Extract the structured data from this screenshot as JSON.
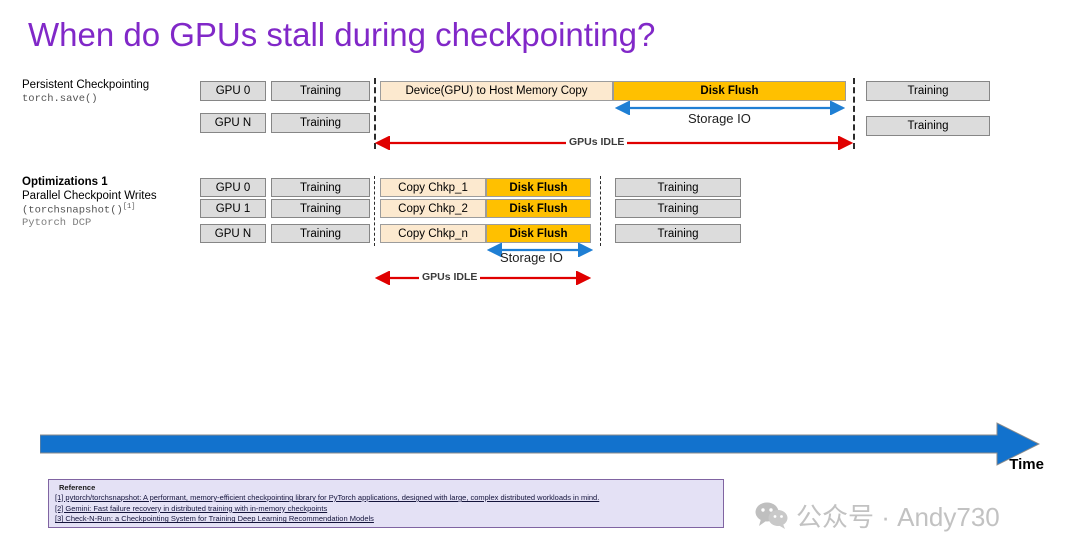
{
  "slide": {
    "title": "When do GPUs stall during checkpointing?",
    "title_color": "#8128C8"
  },
  "sections": [
    {
      "id": "persistent-checkpointing",
      "heading": "Persistent Checkpointing",
      "subheading": "",
      "code_label": "torch.save()",
      "code_label_2": "",
      "rows": [
        {
          "gpu": "GPU 0",
          "training_left": "Training",
          "phases": [
            "Device(GPU) to Host Memory Copy",
            "Disk Flush"
          ],
          "training_right": "Training"
        },
        {
          "gpu": "GPU N",
          "training_left": "Training",
          "phases": [],
          "training_right": "Training"
        }
      ],
      "storage_io_label": "Storage IO",
      "idle_label": "GPUs IDLE"
    },
    {
      "id": "optimizations-1",
      "heading": "Optimizations 1",
      "subheading": "Parallel Checkpoint Writes",
      "code_label": "(torchsnapshot()",
      "code_sup": "[1]",
      "code_label_2": "Pytorch DCP",
      "rows": [
        {
          "gpu": "GPU 0",
          "training_left": "Training",
          "copy": "Copy Chkp_1",
          "flush": "Disk Flush",
          "training_right": "Training"
        },
        {
          "gpu": "GPU 1",
          "training_left": "Training",
          "copy": "Copy Chkp_2",
          "flush": "Disk Flush",
          "training_right": "Training"
        },
        {
          "gpu": "GPU N",
          "training_left": "Training",
          "copy": "Copy Chkp_n",
          "flush": "Disk Flush",
          "training_right": "Training"
        }
      ],
      "storage_io_label": "Storage IO",
      "idle_label": "GPUs IDLE"
    }
  ],
  "axis": {
    "time_label": "Time",
    "arrow_color": "#1272cd"
  },
  "reference": {
    "heading": "Reference",
    "items": [
      "[1] pytorch/torchsnapshot: A performant, memory-efficient checkpointing library for PyTorch applications, designed with large, complex distributed workloads in mind.",
      "[2] Gemini: Fast failure recovery in distributed training with in-memory checkpoints",
      "[3] Check-N-Run: a Checkpointing System for Training Deep Learning Recommendation Models"
    ]
  },
  "watermark": {
    "text": "公众号 · Andy730"
  },
  "colors": {
    "gold": "#ffc000",
    "cream": "#fce9cf",
    "gray_bar": "#dcdcdc",
    "idle_red": "#e00000",
    "storage_blue": "#1f7fd4",
    "title_purple": "#8128C8"
  }
}
